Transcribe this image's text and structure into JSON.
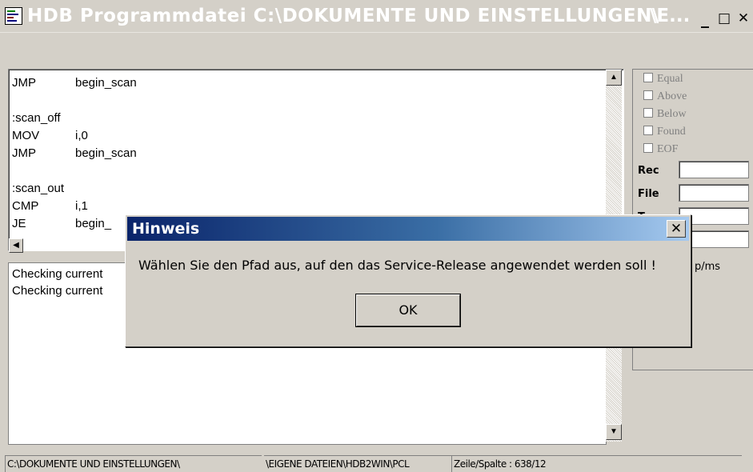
{
  "window": {
    "title": "HDB Programmdatei C:\\DOKUMENTE UND EINSTELLUNGEN\\",
    "title_tail": "\\E...",
    "minimize_label": "_",
    "maximize_label": "□",
    "close_label": "✕"
  },
  "editor": {
    "lines": [
      {
        "op": "JMP",
        "arg": "begin_scan"
      },
      {
        "op": "",
        "arg": ""
      },
      {
        "op": ":scan_off",
        "arg": ""
      },
      {
        "op": "MOV",
        "arg": "i,0"
      },
      {
        "op": "JMP",
        "arg": "begin_scan"
      },
      {
        "op": "",
        "arg": ""
      },
      {
        "op": ":scan_out",
        "arg": ""
      },
      {
        "op": "CMP",
        "arg": "i,1"
      },
      {
        "op": "JE",
        "arg": "begin_"
      }
    ]
  },
  "log": {
    "lines": [
      "Checking current",
      "Checking current"
    ]
  },
  "flags": [
    {
      "label": "Equal",
      "checked": false
    },
    {
      "label": "Above",
      "checked": false
    },
    {
      "label": "Below",
      "checked": false
    },
    {
      "label": "Found",
      "checked": false
    },
    {
      "label": "EOF",
      "checked": false
    }
  ],
  "fields": {
    "rec_label": "Rec",
    "file_label": "File",
    "third_label": "T",
    "rec_value": "",
    "file_value": "",
    "third_value": "",
    "fourth_value": ""
  },
  "side_text": "p/ms",
  "statusbar": {
    "path1": "C:\\DOKUMENTE UND EINSTELLUNGEN\\",
    "path2": "\\EIGENE DATEIEN\\HDB2WIN\\PCL",
    "position": "Zeile/Spalte : 638/12"
  },
  "dialog": {
    "title": "Hinweis",
    "message": "Wählen Sie den Pfad aus, auf den das Service-Release angewendet werden soll !",
    "ok_label": "OK",
    "close_label": "✕"
  },
  "colors": {
    "dialog_title_start": "#0a246a",
    "dialog_title_end": "#a6caf0",
    "window_face": "#d4d0c8"
  }
}
